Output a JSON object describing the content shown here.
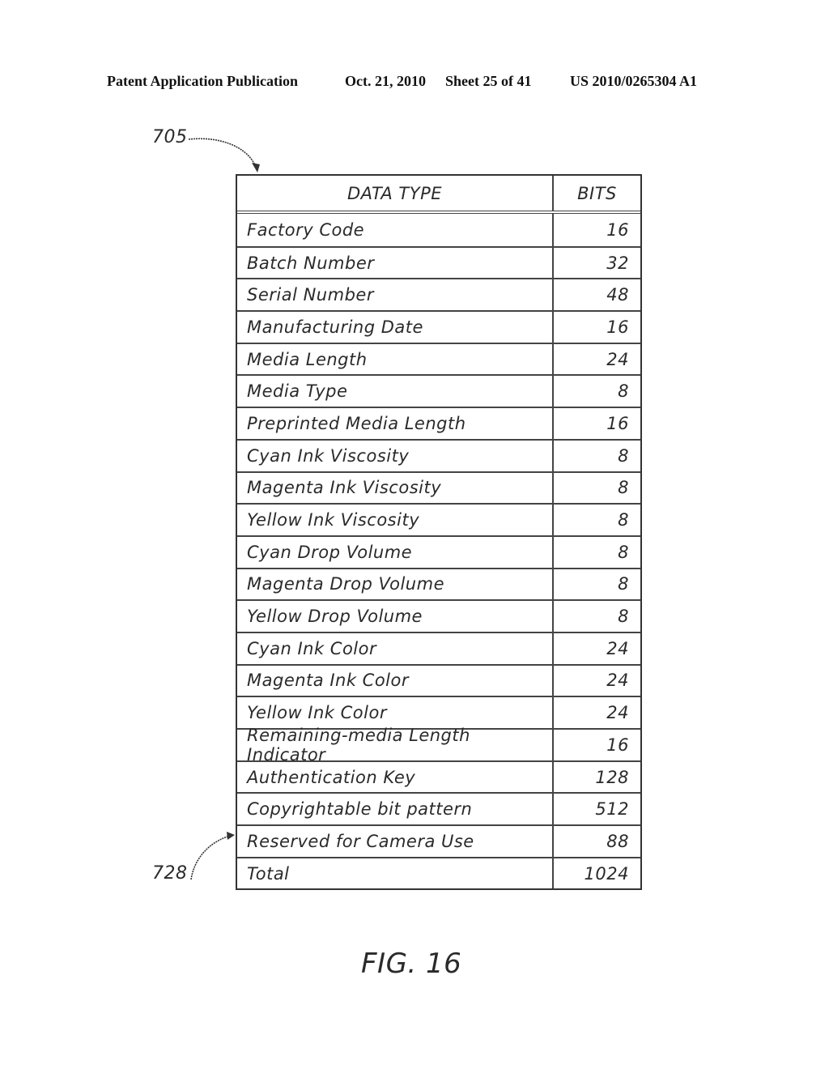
{
  "header": {
    "left": "Patent Application Publication",
    "date": "Oct. 21, 2010",
    "sheet": "Sheet 25 of 41",
    "pub_number": "US 2010/0265304 A1"
  },
  "refs": {
    "table_ref": "705",
    "row_ref": "728"
  },
  "table": {
    "columns": [
      "DATA TYPE",
      "BITS"
    ],
    "rows": [
      {
        "type": "Factory Code",
        "bits": "16"
      },
      {
        "type": "Batch Number",
        "bits": "32"
      },
      {
        "type": "Serial Number",
        "bits": "48"
      },
      {
        "type": "Manufacturing Date",
        "bits": "16"
      },
      {
        "type": "Media Length",
        "bits": "24"
      },
      {
        "type": "Media Type",
        "bits": "8"
      },
      {
        "type": "Preprinted Media Length",
        "bits": "16"
      },
      {
        "type": "Cyan Ink Viscosity",
        "bits": "8"
      },
      {
        "type": "Magenta Ink Viscosity",
        "bits": "8"
      },
      {
        "type": "Yellow Ink Viscosity",
        "bits": "8"
      },
      {
        "type": "Cyan Drop Volume",
        "bits": "8"
      },
      {
        "type": "Magenta Drop Volume",
        "bits": "8"
      },
      {
        "type": "Yellow Drop Volume",
        "bits": "8"
      },
      {
        "type": "Cyan Ink Color",
        "bits": "24"
      },
      {
        "type": "Magenta Ink Color",
        "bits": "24"
      },
      {
        "type": "Yellow Ink Color",
        "bits": "24"
      },
      {
        "type": "Remaining-media Length Indicator",
        "bits": "16"
      },
      {
        "type": "Authentication Key",
        "bits": "128"
      },
      {
        "type": "Copyrightable bit pattern",
        "bits": "512"
      },
      {
        "type": "Reserved for Camera Use",
        "bits": "88"
      },
      {
        "type": "Total",
        "bits": "1024"
      }
    ]
  },
  "figure_label": "FIG. 16"
}
